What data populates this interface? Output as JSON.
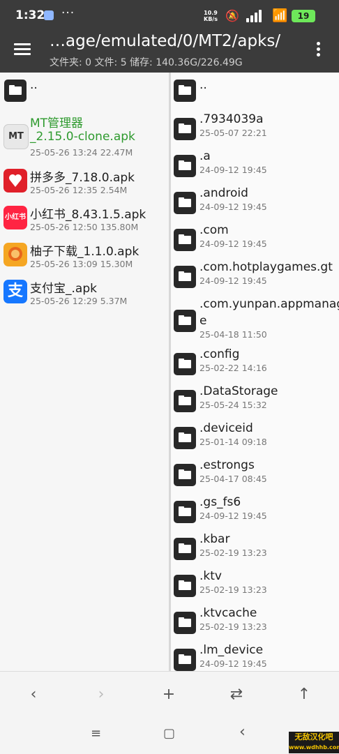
{
  "status": {
    "time": "1:32",
    "dots": "···",
    "net_speed": "10.9",
    "net_unit": "KB/s",
    "battery": "19"
  },
  "header": {
    "path": "…age/emulated/0/MT2/apks/",
    "info": "文件夹: 0  文件: 5  储存: 140.36G/226.49G"
  },
  "left": {
    "up": "..",
    "files": [
      {
        "name1": "MT管理器",
        "name2": "_2.15.0-clone.apk",
        "meta": "25-05-26 13:24  22.47M",
        "icon": "mt-manager-icon",
        "icon_text": "MT",
        "icon_color": "#e8e8e8",
        "highlight": true
      },
      {
        "name1": "拼多多_7.18.0.apk",
        "meta": "25-05-26 12:35  2.54M",
        "icon": "pinduoduo-icon",
        "icon_color": "#e0202a"
      },
      {
        "name1": "小红书_8.43.1.5.apk",
        "meta": "25-05-26 12:50  135.80M",
        "icon": "xiaohongshu-icon",
        "icon_text": "小红书",
        "icon_color": "#ff2442"
      },
      {
        "name1": "柚子下载_1.1.0.apk",
        "meta": "25-05-26 13:09  15.30M",
        "icon": "youzi-icon",
        "icon_color": "#f5a623"
      },
      {
        "name1": "支付宝_.apk",
        "meta": "25-05-26 12:29  5.37M",
        "icon": "alipay-icon",
        "icon_text": "支",
        "icon_color": "#1677ff"
      }
    ]
  },
  "right": {
    "up": "..",
    "folders": [
      {
        "name": ".7934039a",
        "meta": "25-05-07 22:21"
      },
      {
        "name": ".a",
        "meta": "24-09-12 19:45"
      },
      {
        "name": ".android",
        "meta": "24-09-12 19:45"
      },
      {
        "name": ".com",
        "meta": "24-09-12 19:45"
      },
      {
        "name": ".com.hotplaygames.gt",
        "meta": "24-09-12 19:45"
      },
      {
        "name": ".com.yunpan.appmanage",
        "name_wrap": "e",
        "meta": "25-04-18 11:50"
      },
      {
        "name": ".config",
        "meta": "25-02-22 14:16"
      },
      {
        "name": ".DataStorage",
        "meta": "25-05-24 15:32"
      },
      {
        "name": ".deviceid",
        "meta": "25-01-14 09:18"
      },
      {
        "name": ".estrongs",
        "meta": "25-04-17 08:45"
      },
      {
        "name": ".gs_fs6",
        "meta": "24-09-12 19:45"
      },
      {
        "name": ".kbar",
        "meta": "25-02-19 13:23"
      },
      {
        "name": ".ktv",
        "meta": "25-02-19 13:23"
      },
      {
        "name": ".ktvcache",
        "meta": "25-02-19 13:23"
      },
      {
        "name": ".lm_device",
        "meta": "24-09-12 19:45"
      }
    ]
  },
  "toolbar": {
    "back": "‹",
    "forward": "›",
    "add": "+",
    "swap": "⇄",
    "up": "↑"
  },
  "navbar": {
    "menu": "≡",
    "home": "▢",
    "back": "‹"
  },
  "watermark": {
    "line1": "无敌汉化吧",
    "line2": "www.wdhhb.com"
  }
}
